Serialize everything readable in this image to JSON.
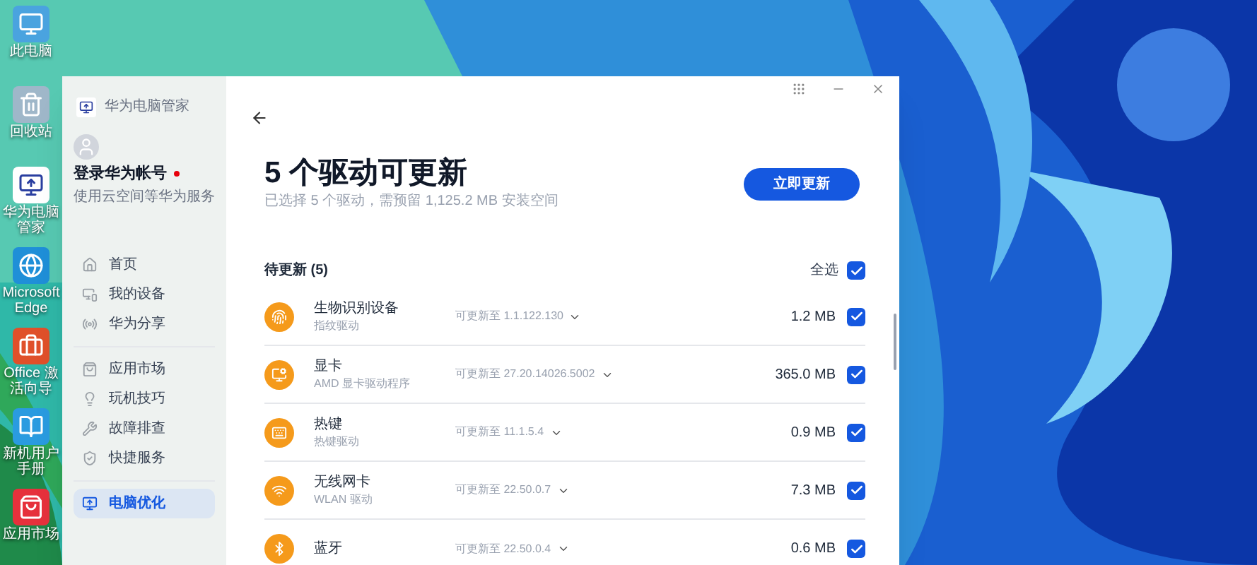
{
  "desktop_icons": [
    {
      "label": "此电脑",
      "kind": "computer"
    },
    {
      "label": "回收站",
      "kind": "recycle"
    },
    {
      "label": "华为电脑管家",
      "kind": "manager"
    },
    {
      "label": "Microsoft Edge",
      "kind": "edge"
    },
    {
      "label": "Office 激活向导",
      "kind": "office"
    },
    {
      "label": "新机用户手册",
      "kind": "manual"
    },
    {
      "label": "应用市场",
      "kind": "store"
    }
  ],
  "window": {
    "app_name": "华为电脑管家"
  },
  "account": {
    "name": "登录华为帐号",
    "notice": true,
    "hint": "使用云空间等华为服务"
  },
  "sidebar": {
    "groups": [
      [
        {
          "label": "首页",
          "kind": "home",
          "selected": false
        },
        {
          "label": "我的设备",
          "kind": "devices",
          "selected": false
        },
        {
          "label": "华为分享",
          "kind": "share",
          "selected": false
        }
      ],
      [
        {
          "label": "应用市场",
          "kind": "store",
          "selected": false
        },
        {
          "label": "玩机技巧",
          "kind": "tips",
          "selected": false
        },
        {
          "label": "故障排查",
          "kind": "wrench",
          "selected": false
        },
        {
          "label": "快捷服务",
          "kind": "service",
          "selected": false
        }
      ],
      [
        {
          "label": "电脑优化",
          "kind": "optimize",
          "selected": true
        }
      ]
    ]
  },
  "header": {
    "title": "5 个驱动可更新",
    "subtitle": "已选择 5 个驱动，需预留 1,125.2 MB 安装空间",
    "button": "立即更新"
  },
  "list": {
    "heading": "待更新 (5)",
    "select_all": {
      "label": "全选",
      "checked": true
    },
    "items": [
      {
        "name": "生物识别设备",
        "description": "指纹驱动",
        "version": "可更新至 1.1.122.130",
        "size": "1.2 MB",
        "kind": "fingerprint",
        "checked": true
      },
      {
        "name": "显卡",
        "description": "AMD 显卡驱动程序",
        "version": "可更新至 27.20.14026.5002",
        "size": "365.0 MB",
        "kind": "display",
        "checked": true
      },
      {
        "name": "热键",
        "description": "热键驱动",
        "version": "可更新至 11.1.5.4",
        "size": "0.9 MB",
        "kind": "hotkey",
        "checked": true
      },
      {
        "name": "无线网卡",
        "description": "WLAN 驱动",
        "version": "可更新至 22.50.0.7",
        "size": "7.3 MB",
        "kind": "wifi",
        "checked": true
      },
      {
        "name": "蓝牙",
        "version": "可更新至 22.50.0.4",
        "size": "0.6 MB",
        "kind": "bluetooth",
        "checked": true
      }
    ]
  }
}
